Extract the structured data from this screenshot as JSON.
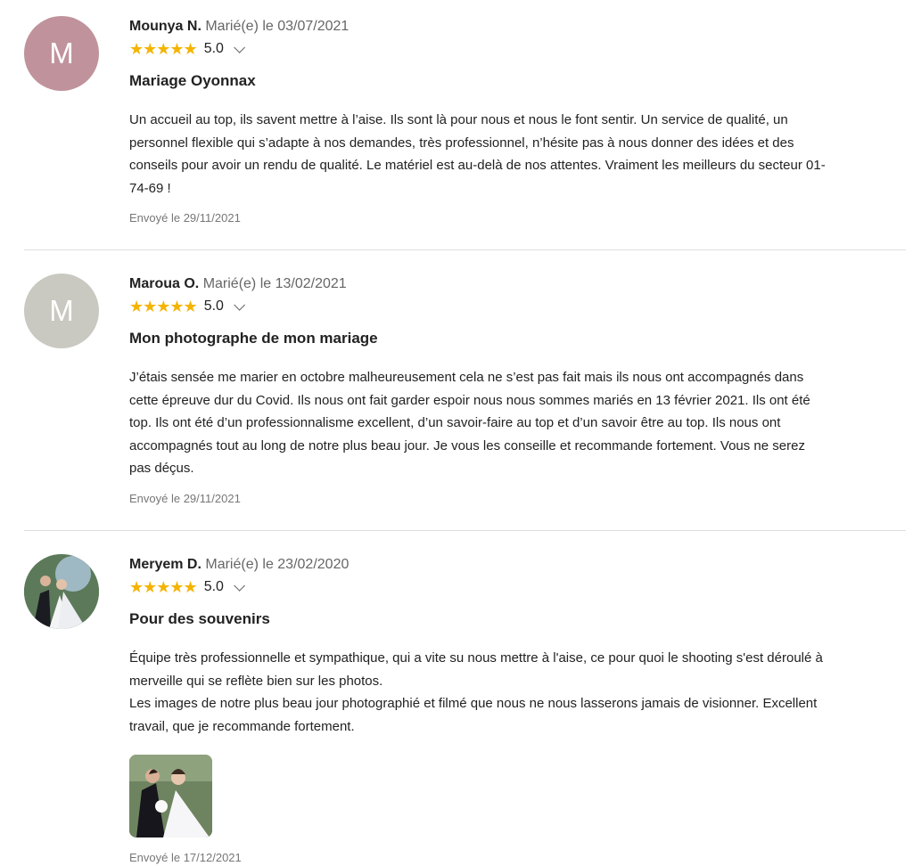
{
  "reviews": [
    {
      "avatar_letter": "M",
      "avatar_color": "#c0939c",
      "author": "Mounya N.",
      "married": "Marié(e) le 03/07/2021",
      "stars": "★★★★★",
      "rating": "5.0",
      "title": "Mariage Oyonnax",
      "body": "Un accueil au top, ils savent mettre à l’aise. Ils sont là pour nous et nous le font sentir. Un service de qualité, un\npersonnel flexible qui s’adapte à nos demandes, très professionnel, n’hésite pas à nous donner des idées et des\nconseils pour avoir un rendu de qualité. Le matériel est au-delà de nos attentes. Vraiment les meilleurs du secteur 01-\n74-69 !",
      "sent": "Envoyé le 29/11/2021"
    },
    {
      "avatar_letter": "M",
      "avatar_color": "#c9c9c1",
      "author": "Maroua O.",
      "married": "Marié(e) le 13/02/2021",
      "stars": "★★★★★",
      "rating": "5.0",
      "title": "Mon photographe de mon mariage",
      "body": "J’étais sensée me marier en octobre malheureusement cela ne s’est pas fait mais ils nous ont accompagnés dans\ncette épreuve dur du Covid. Ils nous ont fait garder espoir nous nous sommes mariés en 13 février 2021. Ils ont été\ntop. Ils ont été d’un professionnalisme excellent, d’un savoir-faire au top et d’un savoir être au top. Ils nous ont\naccompagnés tout au long de notre plus beau jour. Je vous les conseille et recommande fortement. Vous ne serez\npas déçus.",
      "sent": "Envoyé le 29/11/2021"
    },
    {
      "avatar_letter": "",
      "author": "Meryem D.",
      "married": "Marié(e) le 23/02/2020",
      "stars": "★★★★★",
      "rating": "5.0",
      "title": "Pour des souvenirs",
      "body": "Équipe très professionnelle et sympathique, qui a vite su nous mettre à l'aise, ce pour quoi le shooting s'est déroulé à\nmerveille qui se reflète bien sur les photos.\nLes images de notre plus beau jour photographié et filmé que nous ne nous lasserons jamais de visionner. Excellent\ntravail, que je recommande fortement.",
      "sent": "Envoyé le 17/12/2021"
    }
  ],
  "colors": {
    "star": "#f4b400",
    "divider": "#dedede"
  }
}
